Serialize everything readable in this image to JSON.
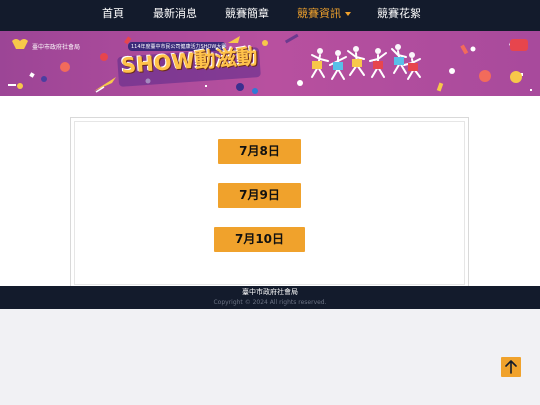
{
  "nav": {
    "items": [
      {
        "label": "首頁"
      },
      {
        "label": "最新消息"
      },
      {
        "label": "競賽簡章"
      },
      {
        "label": "競賽資訊"
      },
      {
        "label": "競賽花絮"
      }
    ],
    "active_index": 3
  },
  "banner": {
    "org_name": "臺中市政府社會局",
    "event_subtitle": "114年度臺中市民公司健康活力SHOW大賽",
    "event_title": "SHOW動滋動"
  },
  "main": {
    "dates": [
      {
        "label": "7月8日"
      },
      {
        "label": "7月9日"
      },
      {
        "label": "7月10日"
      }
    ]
  },
  "footer": {
    "org": "臺中市政府社會局",
    "copyright": "Copyright © 2024 All rights reserved."
  },
  "colors": {
    "navbar": "#131b2c",
    "accent": "#f0a22c",
    "banner": "#a84a9c",
    "page_bg": "#f1f1f4"
  },
  "icons": {
    "back_to_top": "arrow-up-icon",
    "dropdown": "caret-down-icon"
  }
}
